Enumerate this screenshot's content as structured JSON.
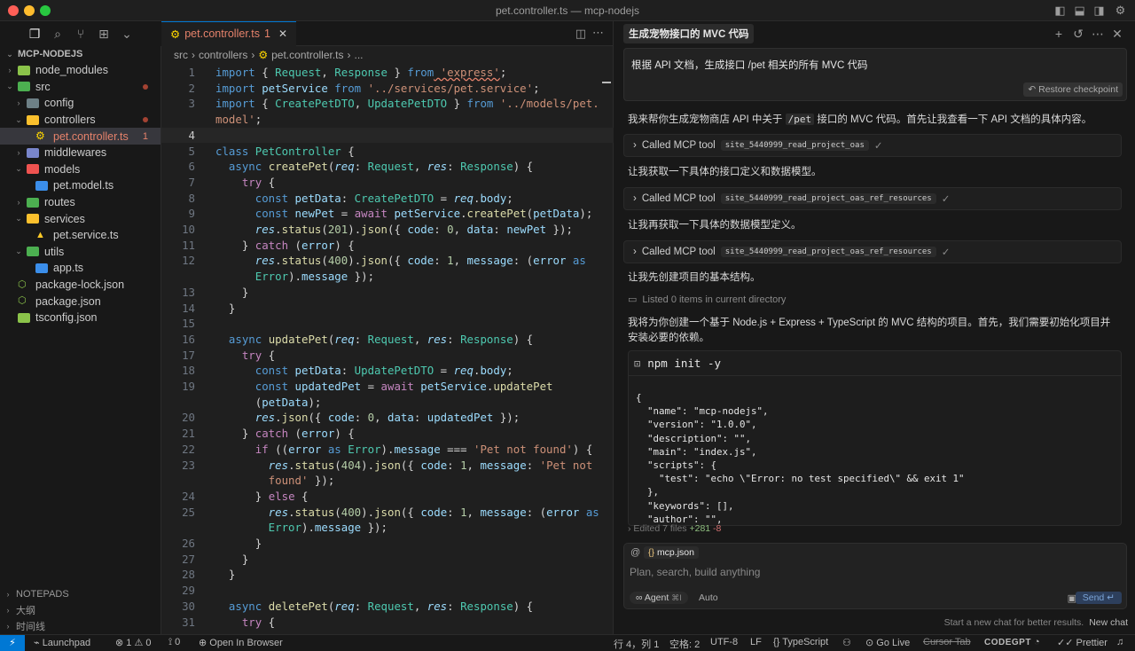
{
  "window": {
    "title": "pet.controller.ts — mcp-nodejs"
  },
  "explorer": {
    "project": "MCP-NODEJS",
    "items": [
      {
        "label": "node_modules",
        "depth": 1,
        "type": "folder",
        "open": false
      },
      {
        "label": "src",
        "depth": 1,
        "type": "folder",
        "open": true
      },
      {
        "label": "config",
        "depth": 2,
        "type": "folder",
        "open": false
      },
      {
        "label": "controllers",
        "depth": 2,
        "type": "folder",
        "open": true
      },
      {
        "label": "pet.controller.ts",
        "depth": 3,
        "type": "file",
        "badge": "1"
      },
      {
        "label": "middlewares",
        "depth": 2,
        "type": "folder",
        "open": false
      },
      {
        "label": "models",
        "depth": 2,
        "type": "folder",
        "open": true
      },
      {
        "label": "pet.model.ts",
        "depth": 3,
        "type": "file"
      },
      {
        "label": "routes",
        "depth": 2,
        "type": "folder",
        "open": false
      },
      {
        "label": "services",
        "depth": 2,
        "type": "folder",
        "open": true
      },
      {
        "label": "pet.service.ts",
        "depth": 3,
        "type": "file"
      },
      {
        "label": "utils",
        "depth": 2,
        "type": "folder",
        "open": true
      },
      {
        "label": "app.ts",
        "depth": 3,
        "type": "file"
      },
      {
        "label": "package-lock.json",
        "depth": 1,
        "type": "file"
      },
      {
        "label": "package.json",
        "depth": 1,
        "type": "file"
      },
      {
        "label": "tsconfig.json",
        "depth": 1,
        "type": "file"
      }
    ],
    "footer": [
      "NOTEPADS",
      "大纲",
      "时间线"
    ]
  },
  "editor": {
    "tab": {
      "label": "pet.controller.ts",
      "badge": "1"
    },
    "breadcrumbs": [
      "src",
      "controllers",
      "pet.controller.ts",
      "..."
    ],
    "current_line": 4,
    "lines": [
      {
        "n": "1",
        "segs": [
          [
            "k",
            "import"
          ],
          [
            "w",
            " { "
          ],
          [
            "c",
            "Request"
          ],
          [
            "w",
            ", "
          ],
          [
            "c",
            "Response"
          ],
          [
            "w",
            " } "
          ],
          [
            "k",
            "from"
          ],
          [
            "s",
            " 'express'"
          ],
          [
            "w",
            ";"
          ]
        ]
      },
      {
        "n": "2",
        "segs": [
          [
            "k",
            "import"
          ],
          [
            "v",
            " petService "
          ],
          [
            "k",
            "from"
          ],
          [
            "s",
            " '../services/pet.service'"
          ],
          [
            "w",
            ";"
          ]
        ]
      },
      {
        "n": "3",
        "segs": [
          [
            "k",
            "import"
          ],
          [
            "w",
            " { "
          ],
          [
            "c",
            "CreatePetDTO"
          ],
          [
            "w",
            ", "
          ],
          [
            "c",
            "UpdatePetDTO"
          ],
          [
            "w",
            " } "
          ],
          [
            "k",
            "from"
          ],
          [
            "s",
            " '../models/pet."
          ]
        ]
      },
      {
        "n": "",
        "segs": [
          [
            "s",
            "model'"
          ],
          [
            "w",
            ";"
          ]
        ]
      },
      {
        "n": "4",
        "segs": []
      },
      {
        "n": "5",
        "segs": [
          [
            "k",
            "class "
          ],
          [
            "c",
            "PetController"
          ],
          [
            "w",
            " {"
          ]
        ]
      },
      {
        "n": "6",
        "segs": [
          [
            "k",
            "  async "
          ],
          [
            "f",
            "createPet"
          ],
          [
            "w",
            "("
          ],
          [
            "it",
            "req"
          ],
          [
            "w",
            ": "
          ],
          [
            "c",
            "Request"
          ],
          [
            "w",
            ", "
          ],
          [
            "it",
            "res"
          ],
          [
            "w",
            ": "
          ],
          [
            "c",
            "Response"
          ],
          [
            "w",
            ") {"
          ]
        ]
      },
      {
        "n": "7",
        "segs": [
          [
            "p",
            "    try"
          ],
          [
            "w",
            " {"
          ]
        ]
      },
      {
        "n": "8",
        "segs": [
          [
            "k",
            "      const "
          ],
          [
            "v",
            "petData"
          ],
          [
            "w",
            ": "
          ],
          [
            "c",
            "CreatePetDTO"
          ],
          [
            "w",
            " = "
          ],
          [
            "it",
            "req"
          ],
          [
            "w",
            "."
          ],
          [
            "v",
            "body"
          ],
          [
            "w",
            ";"
          ]
        ]
      },
      {
        "n": "9",
        "segs": [
          [
            "k",
            "      const "
          ],
          [
            "v",
            "newPet"
          ],
          [
            "w",
            " = "
          ],
          [
            "p",
            "await "
          ],
          [
            "v",
            "petService"
          ],
          [
            "w",
            "."
          ],
          [
            "f",
            "createPet"
          ],
          [
            "w",
            "("
          ],
          [
            "v",
            "petData"
          ],
          [
            "w",
            ");"
          ]
        ]
      },
      {
        "n": "10",
        "segs": [
          [
            "it",
            "      res"
          ],
          [
            "w",
            "."
          ],
          [
            "f",
            "status"
          ],
          [
            "w",
            "("
          ],
          [
            "n",
            "201"
          ],
          [
            "w",
            ")."
          ],
          [
            "f",
            "json"
          ],
          [
            "w",
            "({ "
          ],
          [
            "v",
            "code"
          ],
          [
            "w",
            ": "
          ],
          [
            "n",
            "0"
          ],
          [
            "w",
            ", "
          ],
          [
            "v",
            "data"
          ],
          [
            "w",
            ": "
          ],
          [
            "v",
            "newPet"
          ],
          [
            "w",
            " });"
          ]
        ]
      },
      {
        "n": "11",
        "segs": [
          [
            "w",
            "    } "
          ],
          [
            "p",
            "catch"
          ],
          [
            "w",
            " ("
          ],
          [
            "v",
            "error"
          ],
          [
            "w",
            ") {"
          ]
        ]
      },
      {
        "n": "12",
        "segs": [
          [
            "it",
            "      res"
          ],
          [
            "w",
            "."
          ],
          [
            "f",
            "status"
          ],
          [
            "w",
            "("
          ],
          [
            "n",
            "400"
          ],
          [
            "w",
            ")."
          ],
          [
            "f",
            "json"
          ],
          [
            "w",
            "({ "
          ],
          [
            "v",
            "code"
          ],
          [
            "w",
            ": "
          ],
          [
            "n",
            "1"
          ],
          [
            "w",
            ", "
          ],
          [
            "v",
            "message"
          ],
          [
            "w",
            ": ("
          ],
          [
            "v",
            "error"
          ],
          [
            "k",
            " as"
          ]
        ]
      },
      {
        "n": "",
        "segs": [
          [
            "c",
            "      Error"
          ],
          [
            "w",
            ")."
          ],
          [
            "v",
            "message"
          ],
          [
            "w",
            " });"
          ]
        ]
      },
      {
        "n": "13",
        "segs": [
          [
            "w",
            "    }"
          ]
        ]
      },
      {
        "n": "14",
        "segs": [
          [
            "w",
            "  }"
          ]
        ]
      },
      {
        "n": "15",
        "segs": []
      },
      {
        "n": "16",
        "segs": [
          [
            "k",
            "  async "
          ],
          [
            "f",
            "updatePet"
          ],
          [
            "w",
            "("
          ],
          [
            "it",
            "req"
          ],
          [
            "w",
            ": "
          ],
          [
            "c",
            "Request"
          ],
          [
            "w",
            ", "
          ],
          [
            "it",
            "res"
          ],
          [
            "w",
            ": "
          ],
          [
            "c",
            "Response"
          ],
          [
            "w",
            ") {"
          ]
        ]
      },
      {
        "n": "17",
        "segs": [
          [
            "p",
            "    try"
          ],
          [
            "w",
            " {"
          ]
        ]
      },
      {
        "n": "18",
        "segs": [
          [
            "k",
            "      const "
          ],
          [
            "v",
            "petData"
          ],
          [
            "w",
            ": "
          ],
          [
            "c",
            "UpdatePetDTO"
          ],
          [
            "w",
            " = "
          ],
          [
            "it",
            "req"
          ],
          [
            "w",
            "."
          ],
          [
            "v",
            "body"
          ],
          [
            "w",
            ";"
          ]
        ]
      },
      {
        "n": "19",
        "segs": [
          [
            "k",
            "      const "
          ],
          [
            "v",
            "updatedPet"
          ],
          [
            "w",
            " = "
          ],
          [
            "p",
            "await "
          ],
          [
            "v",
            "petService"
          ],
          [
            "w",
            "."
          ],
          [
            "f",
            "updatePet"
          ]
        ]
      },
      {
        "n": "",
        "segs": [
          [
            "w",
            "      ("
          ],
          [
            "v",
            "petData"
          ],
          [
            "w",
            ");"
          ]
        ]
      },
      {
        "n": "20",
        "segs": [
          [
            "it",
            "      res"
          ],
          [
            "w",
            "."
          ],
          [
            "f",
            "json"
          ],
          [
            "w",
            "({ "
          ],
          [
            "v",
            "code"
          ],
          [
            "w",
            ": "
          ],
          [
            "n",
            "0"
          ],
          [
            "w",
            ", "
          ],
          [
            "v",
            "data"
          ],
          [
            "w",
            ": "
          ],
          [
            "v",
            "updatedPet"
          ],
          [
            "w",
            " });"
          ]
        ]
      },
      {
        "n": "21",
        "segs": [
          [
            "w",
            "    } "
          ],
          [
            "p",
            "catch"
          ],
          [
            "w",
            " ("
          ],
          [
            "v",
            "error"
          ],
          [
            "w",
            ") {"
          ]
        ]
      },
      {
        "n": "22",
        "segs": [
          [
            "p",
            "      if"
          ],
          [
            "w",
            " (("
          ],
          [
            "v",
            "error"
          ],
          [
            "k",
            " as "
          ],
          [
            "c",
            "Error"
          ],
          [
            "w",
            ")."
          ],
          [
            "v",
            "message"
          ],
          [
            "w",
            " === "
          ],
          [
            "s",
            "'Pet not found'"
          ],
          [
            "w",
            ") {"
          ]
        ]
      },
      {
        "n": "23",
        "segs": [
          [
            "it",
            "        res"
          ],
          [
            "w",
            "."
          ],
          [
            "f",
            "status"
          ],
          [
            "w",
            "("
          ],
          [
            "n",
            "404"
          ],
          [
            "w",
            ")."
          ],
          [
            "f",
            "json"
          ],
          [
            "w",
            "({ "
          ],
          [
            "v",
            "code"
          ],
          [
            "w",
            ": "
          ],
          [
            "n",
            "1"
          ],
          [
            "w",
            ", "
          ],
          [
            "v",
            "message"
          ],
          [
            "w",
            ": "
          ],
          [
            "s",
            "'Pet not"
          ]
        ]
      },
      {
        "n": "",
        "segs": [
          [
            "s",
            "        found'"
          ],
          [
            "w",
            " });"
          ]
        ]
      },
      {
        "n": "24",
        "segs": [
          [
            "w",
            "      } "
          ],
          [
            "p",
            "else"
          ],
          [
            "w",
            " {"
          ]
        ]
      },
      {
        "n": "25",
        "segs": [
          [
            "it",
            "        res"
          ],
          [
            "w",
            "."
          ],
          [
            "f",
            "status"
          ],
          [
            "w",
            "("
          ],
          [
            "n",
            "400"
          ],
          [
            "w",
            ")."
          ],
          [
            "f",
            "json"
          ],
          [
            "w",
            "({ "
          ],
          [
            "v",
            "code"
          ],
          [
            "w",
            ": "
          ],
          [
            "n",
            "1"
          ],
          [
            "w",
            ", "
          ],
          [
            "v",
            "message"
          ],
          [
            "w",
            ": ("
          ],
          [
            "v",
            "error"
          ],
          [
            "k",
            " as"
          ]
        ]
      },
      {
        "n": "",
        "segs": [
          [
            "c",
            "        Error"
          ],
          [
            "w",
            ")."
          ],
          [
            "v",
            "message"
          ],
          [
            "w",
            " });"
          ]
        ]
      },
      {
        "n": "26",
        "segs": [
          [
            "w",
            "      }"
          ]
        ]
      },
      {
        "n": "27",
        "segs": [
          [
            "w",
            "    }"
          ]
        ]
      },
      {
        "n": "28",
        "segs": [
          [
            "w",
            "  }"
          ]
        ]
      },
      {
        "n": "29",
        "segs": []
      },
      {
        "n": "30",
        "segs": [
          [
            "k",
            "  async "
          ],
          [
            "f",
            "deletePet"
          ],
          [
            "w",
            "("
          ],
          [
            "it",
            "req"
          ],
          [
            "w",
            ": "
          ],
          [
            "c",
            "Request"
          ],
          [
            "w",
            ", "
          ],
          [
            "it",
            "res"
          ],
          [
            "w",
            ": "
          ],
          [
            "c",
            "Response"
          ],
          [
            "w",
            ") {"
          ]
        ]
      },
      {
        "n": "31",
        "segs": [
          [
            "p",
            "    try"
          ],
          [
            "w",
            " {"
          ]
        ]
      }
    ]
  },
  "chat": {
    "title": "生成宠物接口的 MVC 代码",
    "query": "根据 API 文档，生成接口 /pet 相关的所有 MVC 代码",
    "restore_label": "Restore checkpoint",
    "msg1_pre": "我来帮你生成宠物商店 API 中关于 ",
    "msg1_code": "/pet",
    "msg1_post": " 接口的 MVC 代码。首先让我查看一下 API 文档的具体内容。",
    "tool_label": "Called MCP tool",
    "tool1": "site_5440999_read_project_oas",
    "msg2": "让我获取一下具体的接口定义和数据模型。",
    "tool2": "site_5440999_read_project_oas_ref_resources",
    "msg3": "让我再获取一下具体的数据模型定义。",
    "tool3": "site_5440999_read_project_oas_ref_resources",
    "msg4": "让我先创建项目的基本结构。",
    "listed": "Listed 0 items in current directory",
    "msg5": "我将为你创建一个基于 Node.js + Express + TypeScript 的 MVC 结构的项目。首先，我们需要初始化项目并安装必要的依赖。",
    "terminal_cmd": "npm init -y",
    "terminal_output": "{\n  \"name\": \"mcp-nodejs\",\n  \"version\": \"1.0.0\",\n  \"description\": \"\",\n  \"main\": \"index.js\",\n  \"scripts\": {\n    \"test\": \"echo \\\"Error: no test specified\\\" && exit 1\"\n  },\n  \"keywords\": [],\n  \"author\": \"\",",
    "edited": "Edited 7 files",
    "added": "+281",
    "removed": "-8",
    "context_chip": "mcp.json",
    "placeholder": "Plan, search, build anything",
    "agent_label": "Agent",
    "agent_shortcut": "⌘I",
    "model_label": "Auto",
    "send_label": "Send",
    "hint": "Start a new chat for better results.",
    "new_chat": "New chat"
  },
  "statusbar": {
    "launchpad": "Launchpad",
    "errors": "1",
    "warnings": "0",
    "ports": "0",
    "open_browser": "Open In Browser",
    "position": "行 4，列 1",
    "spaces": "空格: 2",
    "encoding": "UTF-8",
    "eol": "LF",
    "language": "TypeScript",
    "golive": "Go Live",
    "cursor_tab": "Cursor Tab",
    "codegpt": "CODEGPT",
    "prettier": "Prettier"
  },
  "colors": {
    "accent": "#0078d4",
    "error_file": "#e5826b",
    "folder": "#dcb67a",
    "ts_file": "#3b8eea"
  }
}
